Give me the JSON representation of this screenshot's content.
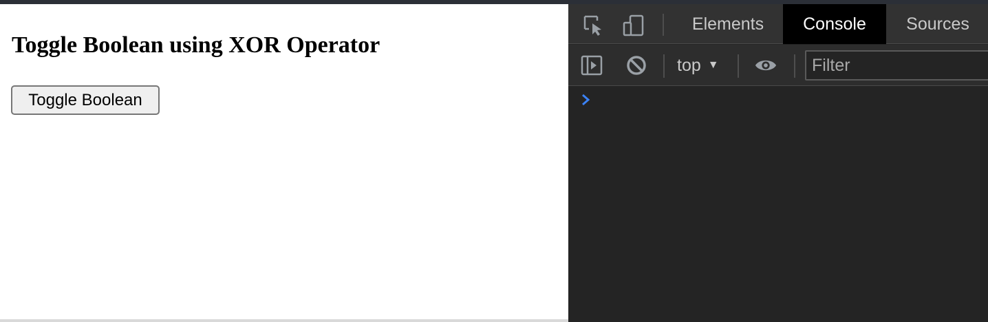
{
  "page": {
    "title": "Toggle Boolean using XOR Operator",
    "button_label": "Toggle Boolean"
  },
  "devtools": {
    "icons": {
      "inspect": "inspect-element-icon",
      "device": "device-toolbar-icon",
      "sidebar": "console-sidebar-icon",
      "clear": "clear-console-icon",
      "eye": "live-expression-eye-icon",
      "prompt": "console-prompt-chevron-icon"
    },
    "tabs": [
      {
        "label": "Elements",
        "active": false
      },
      {
        "label": "Console",
        "active": true
      },
      {
        "label": "Sources",
        "active": false
      }
    ],
    "toolbar": {
      "context": "top",
      "filter_placeholder": "Filter"
    }
  },
  "colors": {
    "devtools_background": "#242424",
    "tabbar_background": "#323232",
    "active_tab": "#000000",
    "prompt_chevron": "#3b82f6"
  }
}
